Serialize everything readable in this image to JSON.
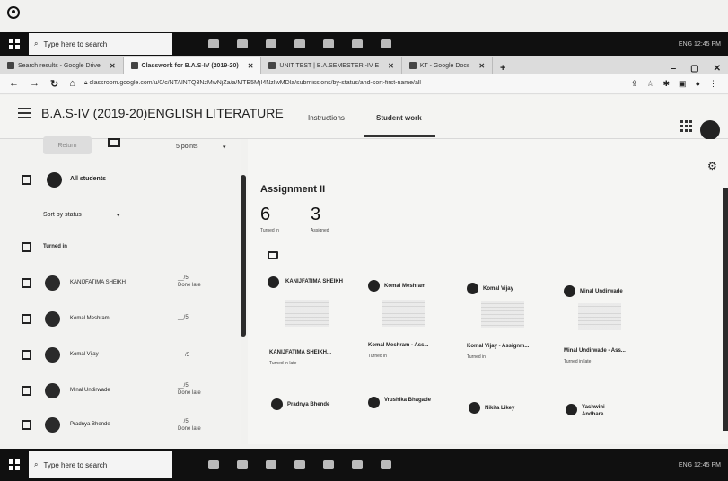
{
  "taskbar": {
    "search_placeholder": "Type here to search",
    "tray_text": "ENG 12:45 PM"
  },
  "browser": {
    "tabs": [
      {
        "label": "Search results - Google Drive",
        "active": false
      },
      {
        "label": "Classwork for B.A.S-IV (2019-20)",
        "active": true
      },
      {
        "label": "UNIT TEST | B.A.SEMESTER -IV E",
        "active": false
      },
      {
        "label": "KT - Google Docs",
        "active": false
      }
    ],
    "new_tab": "+",
    "url": "classroom.google.com/u/0/c/NTAlNTQ3NzMwNjZa/a/MTE5MjI4NzIwMDla/submissions/by-status/and-sort-first-name/all"
  },
  "header": {
    "class_title": "B.A.S-IV (2019-20)ENGLISH LITERATURE",
    "tabs": [
      {
        "label": "Instructions",
        "active": false
      },
      {
        "label": "Student work",
        "active": true
      }
    ]
  },
  "left": {
    "return_label": "Return",
    "points_label": "5 points",
    "all_students_label": "All students",
    "sort_label": "Sort by status",
    "section_label": "Turned in",
    "students": [
      {
        "name": "KANIJFATIMA SHEIKH",
        "grade": "__/5",
        "note": "Done late"
      },
      {
        "name": "Komal Meshram",
        "grade": "__/5",
        "note": ""
      },
      {
        "name": "Komal Vijay",
        "grade": "/5",
        "note": ""
      },
      {
        "name": "Minal Undirwade",
        "grade": "__/5",
        "note": "Done late"
      },
      {
        "name": "Pradnya Bhende",
        "grade": "__/5",
        "note": "Done late"
      }
    ]
  },
  "main": {
    "assignment_title": "Assignment II",
    "turned_in_count": "6",
    "turned_in_label": "Turned in",
    "assigned_count": "3",
    "assigned_label": "Assigned",
    "cards": [
      {
        "name": "KANIJFATIMA SHEIKH",
        "file": "KANIJFATIMA SHEIKH...",
        "status": "Turned in late"
      },
      {
        "name": "Komal Meshram",
        "file": "Komal Meshram - Ass...",
        "status": "Turned in"
      },
      {
        "name": "Komal Vijay",
        "file": "Komal Vijay - Assignm...",
        "status": "Turned in"
      },
      {
        "name": "Minal Undirwade",
        "file": "Minal Undirwade - Ass...",
        "status": "Turned in late"
      },
      {
        "name": "Pradnya Bhende",
        "file": "",
        "status": ""
      },
      {
        "name": "Vrushika Bhagade",
        "file": "",
        "status": ""
      },
      {
        "name": "Nikita Likey",
        "file": "",
        "status": ""
      },
      {
        "name": "Yashwini Andhare",
        "file": "",
        "status": ""
      }
    ]
  }
}
